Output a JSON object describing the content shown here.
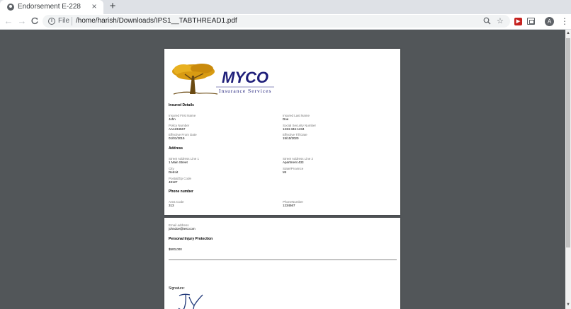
{
  "browser": {
    "tab_title": "Endorsement E-228",
    "tab_close": "×",
    "new_tab": "+",
    "back": "←",
    "forward": "→",
    "reload": "C",
    "info": "i",
    "scheme_label": "File",
    "url": "/home/harish/Downloads/IPS1__TABTHREAD1.pdf",
    "zoom_icon": "⚲",
    "star_icon": "☆",
    "avatar_letter": "A",
    "menu": "⋮"
  },
  "document": {
    "logo": {
      "brand": "MYCO",
      "tagline": "Insurance Services"
    },
    "insured_details": {
      "heading": "Insured Details",
      "first_name": {
        "label": "Insured First Name",
        "value": "John"
      },
      "last_name": {
        "label": "Insured Last Name",
        "value": "Doe"
      },
      "policy_number": {
        "label": "Policy Number",
        "value": "AA1234567"
      },
      "ssn": {
        "label": "Social Security Number",
        "value": "1234-346-1234"
      },
      "effective_from": {
        "label": "Effective From Date",
        "value": "01/01/2015"
      },
      "effective_till": {
        "label": "Effective Till Date",
        "value": "15/10/2020"
      }
    },
    "address": {
      "heading": "Address",
      "line1": {
        "label": "Street Address Line 1",
        "value": "1 Main Street"
      },
      "line2": {
        "label": "Street Address Line 2",
        "value": "Apartment 433"
      },
      "city": {
        "label": "City",
        "value": "Detroit"
      },
      "state": {
        "label": "State/Province",
        "value": "MI"
      },
      "postal": {
        "label": "Postal/Zip Code",
        "value": "48127"
      }
    },
    "phone": {
      "heading": "Phone number",
      "area_code": {
        "label": "Area Code",
        "value": "313"
      },
      "number": {
        "label": "PhoneNumber",
        "value": "1234567"
      }
    },
    "email": {
      "label": "Email address",
      "value": "johndoe@test.com"
    },
    "pip": {
      "heading": "Personal Injury Protection",
      "value": "$500,000"
    },
    "signature_label": "Signature:"
  },
  "colors": {
    "viewer_bg": "#525659",
    "logo_navy": "#1f1f7a",
    "logo_gold": "#d89b12",
    "tree_trunk": "#6b4a12",
    "signature_ink": "#223a7a"
  }
}
